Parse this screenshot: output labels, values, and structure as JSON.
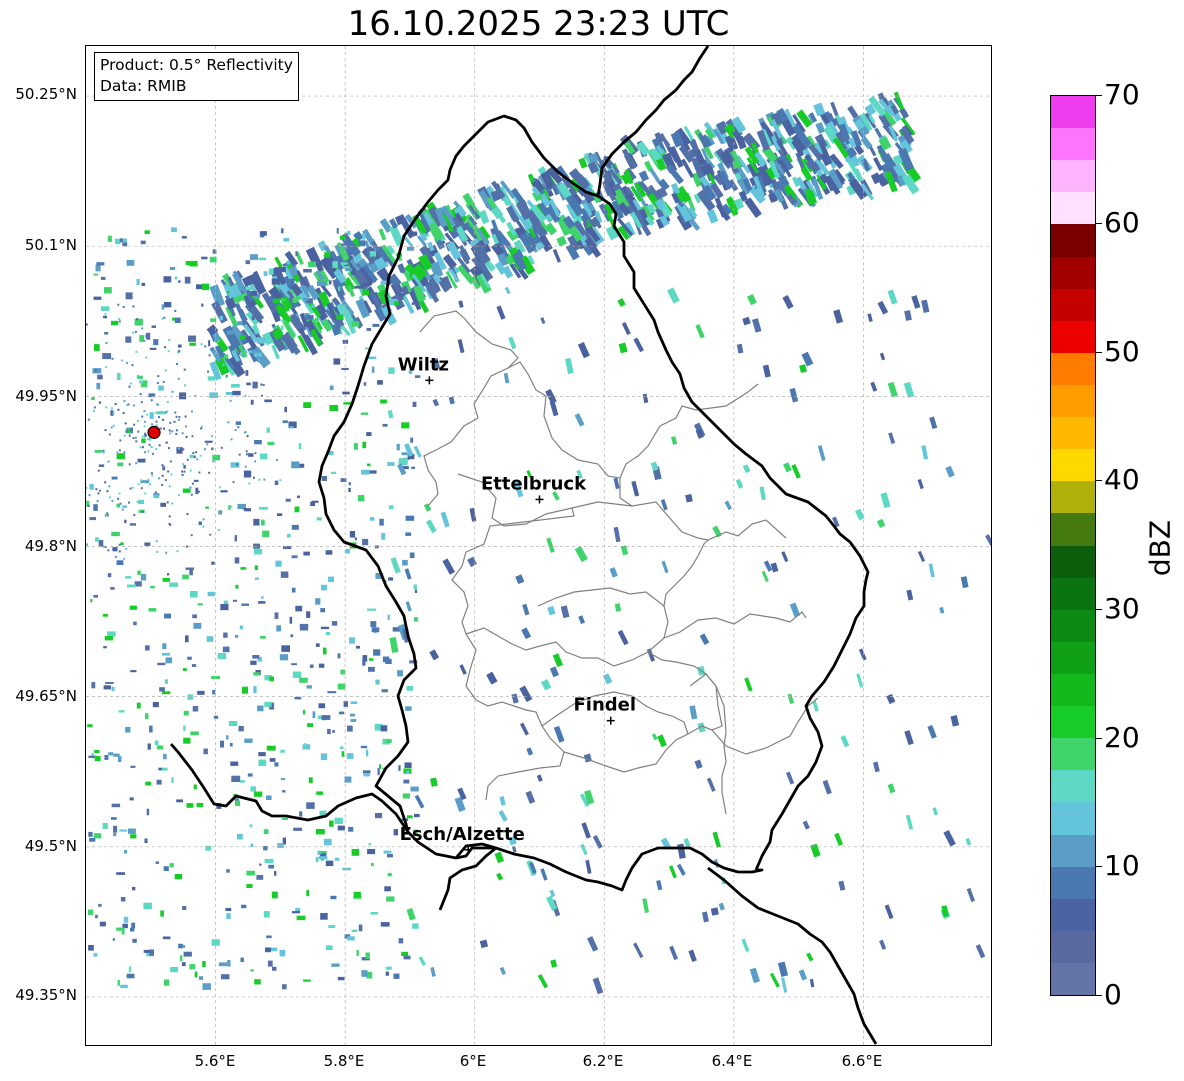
{
  "title": "16.10.2025 23:23 UTC",
  "info": {
    "product": "Product: 0.5° Reflectivity",
    "data": "Data: RMIB"
  },
  "map": {
    "lon_range": [
      5.4,
      6.8
    ],
    "lat_range": [
      49.3,
      50.3
    ],
    "y_ticks": [
      "50.25°N",
      "50.1°N",
      "49.95°N",
      "49.8°N",
      "49.65°N",
      "49.5°N",
      "49.35°N"
    ],
    "x_ticks": [
      "5.6°E",
      "5.8°E",
      "6°E",
      "6.2°E",
      "6.4°E",
      "6.6°E"
    ],
    "radar_site": {
      "lon": 5.505,
      "lat": 49.914,
      "color": "#e00000"
    },
    "cities": [
      {
        "name": "Wiltz",
        "lon": 5.93,
        "lat": 49.966
      },
      {
        "name": "Ettelbruck",
        "lon": 6.1,
        "lat": 49.847
      },
      {
        "name": "Findel",
        "lon": 6.21,
        "lat": 49.626
      },
      {
        "name": "Esch/Alzette",
        "lon": 5.99,
        "lat": 49.497
      }
    ]
  },
  "colorbar": {
    "label": "dBZ",
    "ticks": [
      "0",
      "10",
      "20",
      "30",
      "40",
      "50",
      "60",
      "70"
    ],
    "colors": [
      "#6374a6",
      "#5a6aa0",
      "#4b62a3",
      "#4a79b2",
      "#5a9ec8",
      "#64c4dc",
      "#5dd8c4",
      "#3fd46a",
      "#18cc28",
      "#12b81c",
      "#10a018",
      "#0c8a14",
      "#0a7410",
      "#0a5e0c",
      "#447a10",
      "#b0b00a",
      "#ffd800",
      "#ffb800",
      "#ff9c00",
      "#ff7c00",
      "#ec0000",
      "#c40000",
      "#a00000",
      "#7a0000",
      "#ffe0ff",
      "#ffb4ff",
      "#ff74fc",
      "#ee3cee"
    ]
  }
}
